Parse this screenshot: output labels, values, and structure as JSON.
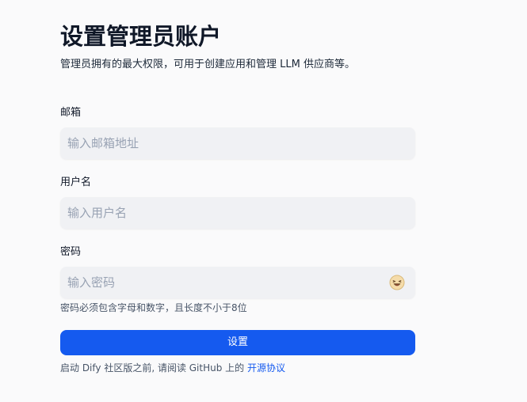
{
  "header": {
    "title": "设置管理员账户",
    "subtitle": "管理员拥有的最大权限，可用于创建应用和管理 LLM 供应商等。"
  },
  "form": {
    "email": {
      "label": "邮箱",
      "placeholder": "输入邮箱地址",
      "value": ""
    },
    "username": {
      "label": "用户名",
      "placeholder": "输入用户名",
      "value": ""
    },
    "password": {
      "label": "密码",
      "placeholder": "输入密码",
      "value": "",
      "toggle_icon": "emoji-face-icon",
      "hint": "密码必须包含字母和数字，且长度不小于8位"
    },
    "submit_label": "设置"
  },
  "footer": {
    "text": "启动 Dify 社区版之前, 请阅读 GitHub 上的 ",
    "link_label": "开源协议"
  },
  "colors": {
    "accent": "#155aef",
    "input_bg": "#f0f1f4",
    "page_bg": "#fafafb"
  }
}
